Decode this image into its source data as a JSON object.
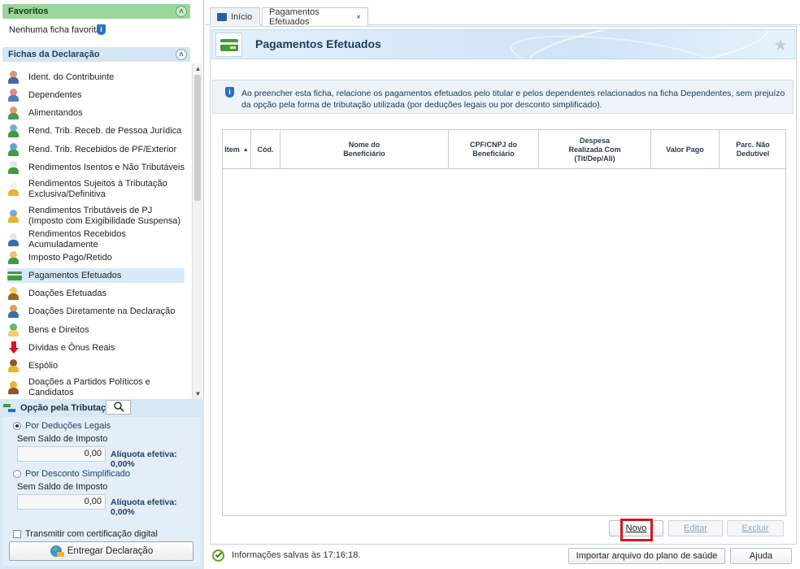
{
  "left": {
    "favoritos": {
      "title": "Favoritos",
      "empty_text": "Nenhuma ficha favorita"
    },
    "fichas": {
      "title": "Fichas da Declaração",
      "items": [
        {
          "label": "Ident. do Contribuinte",
          "icon": "person-icon"
        },
        {
          "label": "Dependentes",
          "icon": "dependents-icon"
        },
        {
          "label": "Alimentandos",
          "icon": "family-icon"
        },
        {
          "label": "Rend. Trib. Receb. de Pessoa Jurídica",
          "icon": "income-pj-icon"
        },
        {
          "label": "Rend. Trib. Recebidos de PF/Exterior",
          "icon": "income-pf-icon"
        },
        {
          "label": "Rendimentos Isentos e Não Tributáveis",
          "icon": "exempt-icon"
        },
        {
          "label": "Rendimentos Sujeitos à Tributação Exclusiva/Definitiva",
          "icon": "warning-doc-icon"
        },
        {
          "label": "Rendimentos Tributáveis de PJ (Imposto com Exigibilidade Suspensa)",
          "icon": "suspended-icon"
        },
        {
          "label": "Rendimentos Recebidos Acumuladamente",
          "icon": "accumulated-icon"
        },
        {
          "label": "Imposto Pago/Retido",
          "icon": "tax-paid-icon"
        },
        {
          "label": "Pagamentos Efetuados",
          "icon": "card-icon",
          "selected": true
        },
        {
          "label": "Doações Efetuadas",
          "icon": "donation-icon"
        },
        {
          "label": "Doações Diretamente na Declaração",
          "icon": "direct-donation-icon"
        },
        {
          "label": "Bens e Direitos",
          "icon": "assets-icon"
        },
        {
          "label": "Dívidas e Ônus Reais",
          "icon": "debt-arrow-icon"
        },
        {
          "label": "Espólio",
          "icon": "chest-icon"
        },
        {
          "label": "Doações a Partidos Políticos e Candidatos",
          "icon": "party-donation-icon"
        }
      ]
    },
    "tributacao": {
      "title": "Opção pela Tributação:",
      "deducoes": {
        "label": "Por Deduções Legais",
        "saldo_label": "Sem Saldo de Imposto",
        "value": "0,00",
        "aliquota": "Alíquota efetiva: 0,00%",
        "selected": true
      },
      "simplificado": {
        "label": "Por Desconto Simplificado",
        "saldo_label": "Sem Saldo de Imposto",
        "value": "0,00",
        "aliquota": "Alíquota efetiva: 0,00%",
        "selected": false
      },
      "certificacao_label": "Transmitir com certificação digital",
      "entregar_label": "Entregar Declaração"
    }
  },
  "tabs": [
    {
      "label": "Início"
    },
    {
      "label": "Pagamentos Efetuados",
      "close": "×",
      "active": true
    }
  ],
  "form": {
    "title": "Pagamentos Efetuados",
    "info": "Ao preencher esta ficha, relacione os pagamentos efetuados pelo titular e pelos dependentes relacionados na ficha Dependentes, sem prejuízo da opção pela forma de tributação utilizada (por deduções legais ou por desconto simplificado).",
    "table": {
      "columns": [
        "Item",
        "Cód.",
        "Nome do Beneficiário",
        "CPF/CNPJ do Beneficiário",
        "Despesa Realizada Com (Tit/Dep/Ali)",
        "Valor Pago",
        "Parc. Não Dedutível"
      ],
      "rows": []
    },
    "buttons": {
      "novo": "Novo",
      "editar": "Editar",
      "excluir": "Excluir"
    }
  },
  "status": {
    "text": "Informações salvas às 17:16:18.",
    "importar_label": "Importar arquivo do plano de saúde",
    "ajuda_label": "Ajuda"
  },
  "colors": {
    "favoritos_header": "#9bd59b",
    "fichas_header": "#d4e6f4",
    "selected_item": "#d8e9f7",
    "novo_highlight": "#d6151e"
  }
}
